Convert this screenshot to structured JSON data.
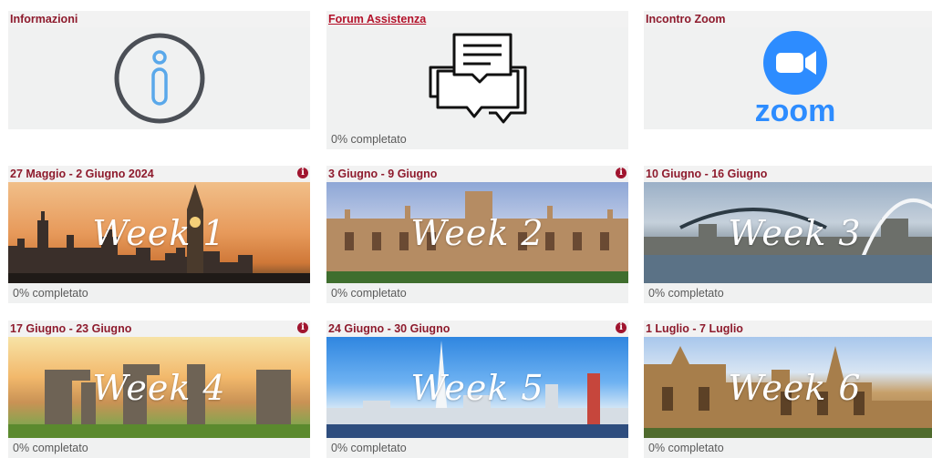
{
  "top_cards": [
    {
      "title": "Informazioni",
      "icon": "info-icon",
      "progress": ""
    },
    {
      "title": "Forum Assistenza",
      "icon": "chat-bubbles-icon",
      "progress": "0% completato"
    },
    {
      "title": "Incontro Zoom",
      "icon": "zoom-logo-icon",
      "progress": "",
      "logo_text": "zoom"
    }
  ],
  "weeks": [
    {
      "title": "27 Maggio - 2 Giugno 2024",
      "banner": "Week 1",
      "progress": "0% completato",
      "has_info": true
    },
    {
      "title": "3 Giugno - 9 Giugno",
      "banner": "Week 2",
      "progress": "0% completato",
      "has_info": true
    },
    {
      "title": "10 Giugno - 16 Giugno",
      "banner": "Week 3",
      "progress": "0% completato",
      "has_info": false
    },
    {
      "title": "17 Giugno - 23 Giugno",
      "banner": "Week 4",
      "progress": "0% completato",
      "has_info": true
    },
    {
      "title": "24 Giugno - 30 Giugno",
      "banner": "Week 5",
      "progress": "0% completato",
      "has_info": true
    },
    {
      "title": "1 Luglio - 7 Luglio",
      "banner": "Week 6",
      "progress": "0% completato",
      "has_info": false
    }
  ],
  "info_symbol": "i",
  "colors": {
    "title": "#8e1b2d",
    "info_dot": "#a0152f",
    "zoom_blue": "#2D8CFF"
  }
}
